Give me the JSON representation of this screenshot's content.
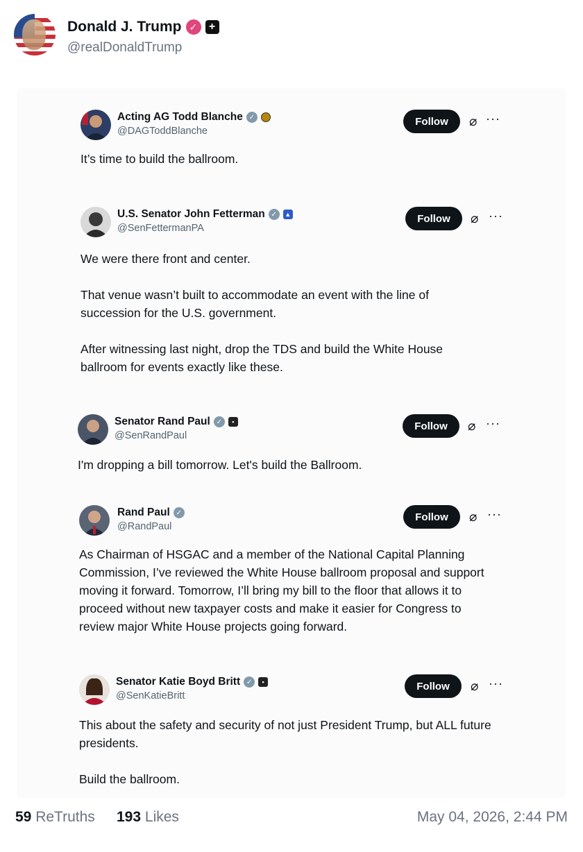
{
  "author": {
    "name": "Donald J. Trump",
    "handle": "@realDonaldTrump",
    "verified_icon": "check-circle-icon",
    "badge_icon": "plus-badge-icon",
    "verified_color": "#e0457b"
  },
  "quoted_posts": [
    {
      "name": "Acting AG Todd Blanche",
      "handle": "@DAGToddBlanche",
      "follow_label": "Follow",
      "paragraphs": [
        "It’s time to build the ballroom."
      ]
    },
    {
      "name": "U.S. Senator John Fetterman",
      "handle": "@SenFettermanPA",
      "follow_label": "Follow",
      "paragraphs": [
        "We were there front and center.",
        "That venue wasn’t built to accommodate an event with the line of succession for the U.S. government.",
        "After witnessing last night, drop the TDS and build the White House ballroom for events exactly like these."
      ]
    },
    {
      "name": "Senator Rand Paul",
      "handle": "@SenRandPaul",
      "follow_label": "Follow",
      "paragraphs": [
        "I'm dropping a bill tomorrow. Let's build the Ballroom."
      ]
    },
    {
      "name": "Rand Paul",
      "handle": "@RandPaul",
      "follow_label": "Follow",
      "paragraphs": [
        "As Chairman of HSGAC and a member of the National Capital Planning Commission, I’ve reviewed the White House ballroom proposal and support moving it forward. Tomorrow, I’ll bring my bill to the floor that allows it to proceed without new taxpayer costs and make it easier for Congress to review major White House projects going forward."
      ]
    },
    {
      "name": "Senator Katie Boyd Britt",
      "handle": "@SenKatieBritt",
      "follow_label": "Follow",
      "paragraphs": [
        "This about the safety and security of not just President Trump, but ALL future presidents.",
        "Build the ballroom."
      ]
    }
  ],
  "stats": {
    "retruths_count": "59",
    "retruths_label": "ReTruths",
    "likes_count": "193",
    "likes_label": "Likes"
  },
  "timestamp": "May 04, 2026, 2:44 PM"
}
